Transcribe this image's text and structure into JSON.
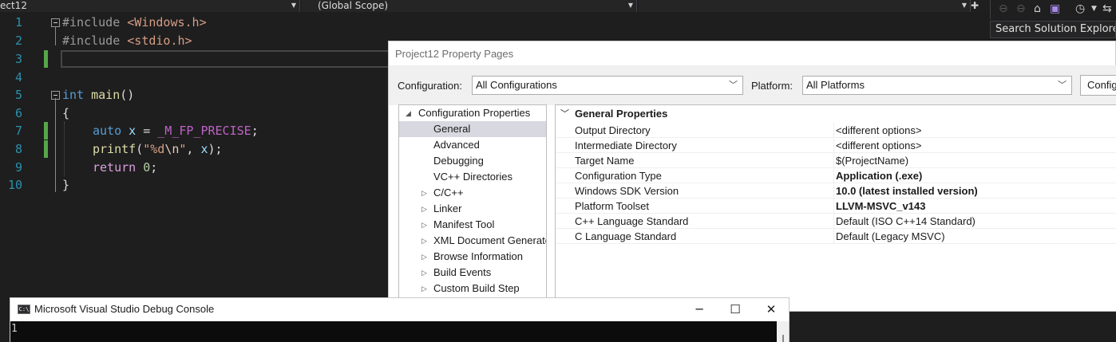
{
  "toolbar": {
    "project_combo": "ect12",
    "scope_combo": "(Global Scope)",
    "member_combo": ""
  },
  "solution_explorer": {
    "search_placeholder": "Search Solution Explorer ("
  },
  "editor": {
    "lines": [
      {
        "num": "1"
      },
      {
        "num": "2"
      },
      {
        "num": "3"
      },
      {
        "num": "4"
      },
      {
        "num": "5"
      },
      {
        "num": "6"
      },
      {
        "num": "7"
      },
      {
        "num": "8"
      },
      {
        "num": "9"
      },
      {
        "num": "10"
      }
    ],
    "tokens": {
      "l1_pp": "#include ",
      "l1_inc": "<Windows.h>",
      "l2_pp": "#include ",
      "l2_inc": "<stdio.h>",
      "l5_kw": "int",
      "l5_fn": "main",
      "l5_rest": "()",
      "l6": "{",
      "l7_kw": "auto",
      "l7_var": "x",
      "l7_eq": " = ",
      "l7_mac": "_M_FP_PRECISE",
      "l7_end": ";",
      "l8_fn": "printf",
      "l8_p1": "(",
      "l8_s1": "\"%d",
      "l8_esc": "\\n",
      "l8_s2": "\"",
      "l8_p2": ", ",
      "l8_var": "x",
      "l8_end": ");",
      "l9_kw": "return",
      "l9_num": "0",
      "l9_end": ";",
      "l10": "}"
    }
  },
  "dialog": {
    "title": "Project12 Property Pages",
    "configuration_label": "Configuration:",
    "configuration_value": "All Configurations",
    "platform_label": "Platform:",
    "platform_value": "All Platforms",
    "config_manager_button": "Configuration Manager...",
    "tree": [
      {
        "label": "Configuration Properties",
        "expander": "◢"
      },
      {
        "label": "General",
        "expander": ""
      },
      {
        "label": "Advanced",
        "expander": ""
      },
      {
        "label": "Debugging",
        "expander": ""
      },
      {
        "label": "VC++ Directories",
        "expander": ""
      },
      {
        "label": "C/C++",
        "expander": "▷"
      },
      {
        "label": "Linker",
        "expander": "▷"
      },
      {
        "label": "Manifest Tool",
        "expander": "▷"
      },
      {
        "label": "XML Document Generator",
        "expander": "▷"
      },
      {
        "label": "Browse Information",
        "expander": "▷"
      },
      {
        "label": "Build Events",
        "expander": "▷"
      },
      {
        "label": "Custom Build Step",
        "expander": "▷"
      }
    ],
    "grid_header": "General Properties",
    "grid_rows": [
      {
        "name": "Output Directory",
        "value": "<different options>"
      },
      {
        "name": "Intermediate Directory",
        "value": "<different options>"
      },
      {
        "name": "Target Name",
        "value": "$(ProjectName)"
      },
      {
        "name": "Configuration Type",
        "value": "Application (.exe)"
      },
      {
        "name": "Windows SDK Version",
        "value": "10.0 (latest installed version)"
      },
      {
        "name": "Platform Toolset",
        "value": "LLVM-MSVC_v143"
      },
      {
        "name": "C++ Language Standard",
        "value": "Default (ISO C++14 Standard)"
      },
      {
        "name": "C Language Standard",
        "value": "Default (Legacy MSVC)"
      }
    ]
  },
  "console": {
    "icon_text": "C:\\",
    "title": "Microsoft Visual Studio Debug Console",
    "minimize": "─",
    "maximize": "☐",
    "close": "✕",
    "output": "1"
  }
}
